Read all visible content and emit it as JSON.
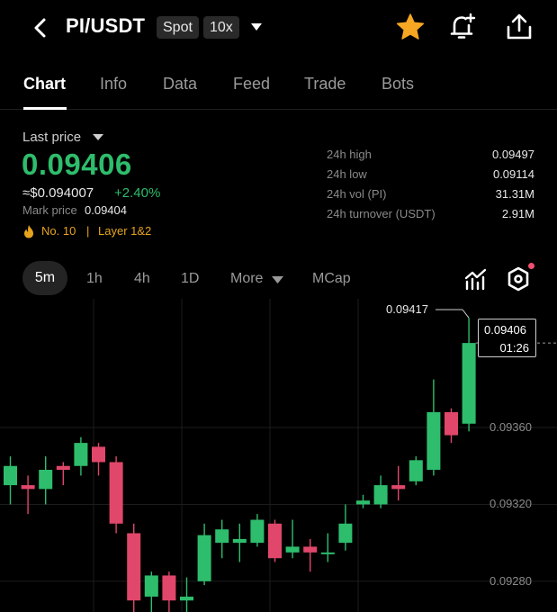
{
  "header": {
    "pair": "PI/USDT",
    "market_type": "Spot",
    "leverage": "10x",
    "icons": [
      "back-arrow-icon",
      "chevron-down-icon",
      "star-icon",
      "bell-plus-icon",
      "share-icon"
    ],
    "star_color": "#f5a623"
  },
  "tabs": [
    {
      "label": "Chart",
      "active": true
    },
    {
      "label": "Info",
      "active": false
    },
    {
      "label": "Data",
      "active": false
    },
    {
      "label": "Feed",
      "active": false
    },
    {
      "label": "Trade",
      "active": false
    },
    {
      "label": "Bots",
      "active": false
    }
  ],
  "summary": {
    "last_price_label": "Last price",
    "last_price": "0.09406",
    "usd_price": "≈$0.094007",
    "change": "+2.40%",
    "mark_price_label": "Mark price",
    "mark_price": "0.09404",
    "rank": "No. 10",
    "separator": "|",
    "sector": "Layer 1&2",
    "up_color": "#2ebd6c",
    "down_color": "#e0476a",
    "accent_color": "#e6a31e"
  },
  "stats": [
    {
      "label": "24h high",
      "value": "0.09497"
    },
    {
      "label": "24h low",
      "value": "0.09114"
    },
    {
      "label": "24h vol (PI)",
      "value": "31.31M"
    },
    {
      "label": "24h turnover (USDT)",
      "value": "2.91M"
    }
  ],
  "intervals": {
    "items": [
      {
        "label": "5m",
        "active": true
      },
      {
        "label": "1h",
        "active": false
      },
      {
        "label": "4h",
        "active": false
      },
      {
        "label": "1D",
        "active": false
      },
      {
        "label": "More",
        "active": false
      },
      {
        "label": "MCap",
        "active": false
      }
    ],
    "icons": [
      "indicator-chart-icon",
      "settings-hexagon-icon"
    ]
  },
  "chart_data": {
    "type": "candlestick",
    "y_ticks": [
      "0.09360",
      "0.09320",
      "0.09280"
    ],
    "y_tick_values": [
      0.0936,
      0.0932,
      0.0928
    ],
    "ylim": [
      0.09264,
      0.09427
    ],
    "grid": true,
    "high_marker": "0.09417",
    "current_price": "0.09406",
    "countdown": "01:26",
    "candles": [
      {
        "o": 0.0933,
        "h": 0.09345,
        "l": 0.0932,
        "c": 0.0934
      },
      {
        "o": 0.0933,
        "h": 0.09335,
        "l": 0.09315,
        "c": 0.09328
      },
      {
        "o": 0.09328,
        "h": 0.09345,
        "l": 0.0932,
        "c": 0.09338
      },
      {
        "o": 0.0934,
        "h": 0.09342,
        "l": 0.0933,
        "c": 0.09338
      },
      {
        "o": 0.0934,
        "h": 0.09355,
        "l": 0.09335,
        "c": 0.09352
      },
      {
        "o": 0.0935,
        "h": 0.09352,
        "l": 0.09335,
        "c": 0.09342
      },
      {
        "o": 0.09342,
        "h": 0.09345,
        "l": 0.09305,
        "c": 0.0931
      },
      {
        "o": 0.09305,
        "h": 0.0931,
        "l": 0.09262,
        "c": 0.0927
      },
      {
        "o": 0.09272,
        "h": 0.09285,
        "l": 0.09262,
        "c": 0.09283
      },
      {
        "o": 0.09283,
        "h": 0.09285,
        "l": 0.09264,
        "c": 0.0927
      },
      {
        "o": 0.0927,
        "h": 0.09282,
        "l": 0.09262,
        "c": 0.09272
      },
      {
        "o": 0.0928,
        "h": 0.0931,
        "l": 0.09278,
        "c": 0.09304
      },
      {
        "o": 0.093,
        "h": 0.09312,
        "l": 0.09292,
        "c": 0.09307
      },
      {
        "o": 0.093,
        "h": 0.0931,
        "l": 0.0929,
        "c": 0.09302
      },
      {
        "o": 0.093,
        "h": 0.09315,
        "l": 0.09298,
        "c": 0.09312
      },
      {
        "o": 0.0931,
        "h": 0.09312,
        "l": 0.0929,
        "c": 0.09292
      },
      {
        "o": 0.09295,
        "h": 0.09312,
        "l": 0.09292,
        "c": 0.09298
      },
      {
        "o": 0.09298,
        "h": 0.09302,
        "l": 0.09285,
        "c": 0.09295
      },
      {
        "o": 0.09295,
        "h": 0.09305,
        "l": 0.0929,
        "c": 0.09295
      },
      {
        "o": 0.093,
        "h": 0.0932,
        "l": 0.09296,
        "c": 0.0931
      },
      {
        "o": 0.0932,
        "h": 0.09325,
        "l": 0.09318,
        "c": 0.09322
      },
      {
        "o": 0.0932,
        "h": 0.09335,
        "l": 0.09318,
        "c": 0.0933
      },
      {
        "o": 0.0933,
        "h": 0.0934,
        "l": 0.09322,
        "c": 0.09328
      },
      {
        "o": 0.09332,
        "h": 0.09345,
        "l": 0.0933,
        "c": 0.09343
      },
      {
        "o": 0.09338,
        "h": 0.09385,
        "l": 0.09335,
        "c": 0.09368
      },
      {
        "o": 0.09368,
        "h": 0.0937,
        "l": 0.09352,
        "c": 0.09356
      },
      {
        "o": 0.09362,
        "h": 0.09417,
        "l": 0.09358,
        "c": 0.09404
      }
    ]
  }
}
